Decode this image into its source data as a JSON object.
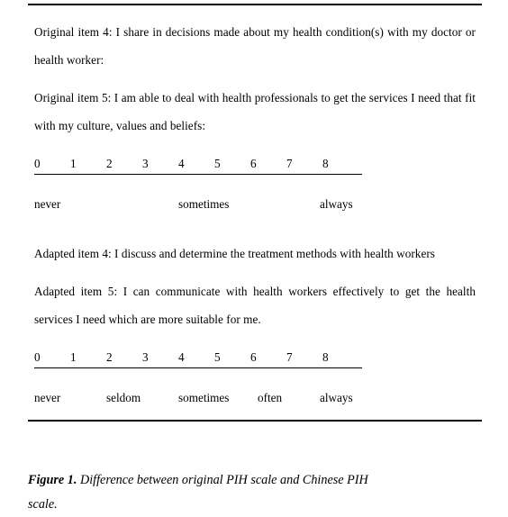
{
  "document": {
    "figure": {
      "items": [
        {
          "id": "original-item-4",
          "text": "Original item 4: I share in decisions made about my health condition(s) with my doctor or health worker:"
        },
        {
          "id": "original-item-5",
          "text": "Original item 5: I am able to deal with health professionals to get the services I need that fit with my culture, values and beliefs:"
        }
      ],
      "original_scale": {
        "id": "original-pih-scale",
        "numbers": [
          "0",
          "1",
          "2",
          "3",
          "4",
          "5",
          "6",
          "7",
          "8"
        ],
        "anchors": [
          {
            "label": "never",
            "at": 0
          },
          {
            "label": "sometimes",
            "at": 4
          },
          {
            "label": "always",
            "at": 8
          }
        ]
      },
      "adapted_items": [
        {
          "id": "adapted-item-4",
          "text": "Adapted item 4: I discuss and determine the treatment methods with health workers"
        },
        {
          "id": "adapted-item-5",
          "text": "Adapted item 5: I can communicate with health workers effectively to get the health services I need which are more suitable for me."
        }
      ],
      "adapted_scale": {
        "id": "chinese-pih-scale",
        "numbers": [
          "0",
          "1",
          "2",
          "3",
          "4",
          "5",
          "6",
          "7",
          "8"
        ],
        "anchors": [
          {
            "label": "never",
            "at": 0
          },
          {
            "label": "seldom",
            "at": 2
          },
          {
            "label": "sometimes",
            "at": 4
          },
          {
            "label": "often",
            "at": 6
          },
          {
            "label": "always",
            "at": 8
          }
        ]
      }
    },
    "caption": {
      "label": "Figure 1.",
      "text": " Difference between original PIH scale and Chinese PIH",
      "line2": "scale."
    }
  }
}
